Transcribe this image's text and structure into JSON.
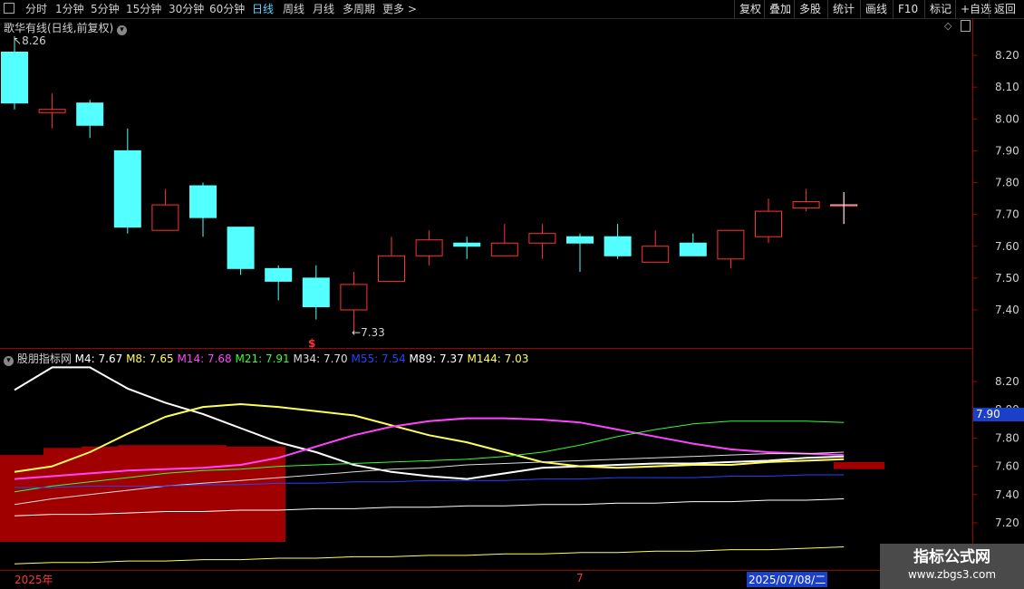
{
  "toolbar": {
    "menu_icon": "square-icon",
    "periods": [
      "分时",
      "1分钟",
      "5分钟",
      "15分钟",
      "30分钟",
      "60分钟",
      "日线",
      "周线",
      "月线",
      "多周期"
    ],
    "active_period": "日线",
    "more": "更多",
    "right_buttons": [
      "复权",
      "叠加",
      "多股",
      "统计",
      "画线",
      "F10",
      "标记",
      "+自选",
      "返回"
    ]
  },
  "price_panel": {
    "title": "歌华有线(日线,前复权)",
    "high_marker": "8.26",
    "low_marker": "7.33",
    "signal_mark": "$",
    "y_ticks": [
      "8.20",
      "8.10",
      "8.00",
      "7.90",
      "7.80",
      "7.70",
      "7.60",
      "7.50",
      "7.40"
    ]
  },
  "indicator_panel": {
    "title": "股朋指标网",
    "ma_values": [
      {
        "label": "M4: 7.67",
        "color": "#ffffff"
      },
      {
        "label": "M8: 7.65",
        "color": "#ffff55"
      },
      {
        "label": "M14: 7.68",
        "color": "#ff44ff"
      },
      {
        "label": "M21: 7.91",
        "color": "#33ff33"
      },
      {
        "label": "M34: 7.70",
        "color": "#dddddd"
      },
      {
        "label": "M55: 7.54",
        "color": "#2244ff"
      },
      {
        "label": "M89: 7.37",
        "color": "#ffffff"
      },
      {
        "label": "M144: 7.03",
        "color": "#ffff55"
      }
    ],
    "y_ticks": [
      "8.20",
      "8.00",
      "7.80",
      "7.60",
      "7.40",
      "7.20"
    ],
    "current_value": "7.90"
  },
  "date_axis": {
    "start": "2025年",
    "month": "7",
    "cursor_date": "2025/07/08/二"
  },
  "watermark": {
    "line1": "指标公式网",
    "line2": "www.zbgs3.com"
  },
  "colors": {
    "up": "#ff3333",
    "down": "#54ffff",
    "axis": "#a00000",
    "background": "#000000",
    "block": "#a00000"
  },
  "chart_data": {
    "type": "candlestick",
    "ylim": [
      7.3,
      8.3
    ],
    "candles": [
      {
        "o": 8.21,
        "h": 8.26,
        "l": 8.03,
        "c": 8.05
      },
      {
        "o": 8.02,
        "h": 8.08,
        "l": 7.97,
        "c": 8.03
      },
      {
        "o": 8.05,
        "h": 8.06,
        "l": 7.94,
        "c": 7.98
      },
      {
        "o": 7.9,
        "h": 7.97,
        "l": 7.64,
        "c": 7.66
      },
      {
        "o": 7.65,
        "h": 7.78,
        "l": 7.65,
        "c": 7.73
      },
      {
        "o": 7.79,
        "h": 7.8,
        "l": 7.63,
        "c": 7.69
      },
      {
        "o": 7.66,
        "h": 7.66,
        "l": 7.51,
        "c": 7.53
      },
      {
        "o": 7.53,
        "h": 7.54,
        "l": 7.43,
        "c": 7.49
      },
      {
        "o": 7.5,
        "h": 7.54,
        "l": 7.37,
        "c": 7.41
      },
      {
        "o": 7.4,
        "h": 7.52,
        "l": 7.33,
        "c": 7.48
      },
      {
        "o": 7.49,
        "h": 7.63,
        "l": 7.49,
        "c": 7.57
      },
      {
        "o": 7.57,
        "h": 7.65,
        "l": 7.54,
        "c": 7.62
      },
      {
        "o": 7.61,
        "h": 7.63,
        "l": 7.56,
        "c": 7.6
      },
      {
        "o": 7.57,
        "h": 7.67,
        "l": 7.57,
        "c": 7.61
      },
      {
        "o": 7.61,
        "h": 7.67,
        "l": 7.56,
        "c": 7.64
      },
      {
        "o": 7.63,
        "h": 7.64,
        "l": 7.52,
        "c": 7.61
      },
      {
        "o": 7.63,
        "h": 7.67,
        "l": 7.56,
        "c": 7.57
      },
      {
        "o": 7.55,
        "h": 7.65,
        "l": 7.55,
        "c": 7.6
      },
      {
        "o": 7.61,
        "h": 7.64,
        "l": 7.57,
        "c": 7.57
      },
      {
        "o": 7.56,
        "h": 7.65,
        "l": 7.53,
        "c": 7.65
      },
      {
        "o": 7.63,
        "h": 7.75,
        "l": 7.61,
        "c": 7.71
      },
      {
        "o": 7.72,
        "h": 7.78,
        "l": 7.71,
        "c": 7.74
      },
      {
        "o": 7.73,
        "h": 7.77,
        "l": 7.67,
        "c": 7.73
      }
    ],
    "indicator_ylim": [
      7.05,
      8.35
    ],
    "series": [
      {
        "name": "M4",
        "color": "#ffffff",
        "width": 2,
        "values": [
          8.14,
          8.3,
          8.3,
          8.15,
          8.05,
          7.97,
          7.87,
          7.77,
          7.7,
          7.61,
          7.56,
          7.53,
          7.51,
          7.55,
          7.59,
          7.6,
          7.61,
          7.62,
          7.62,
          7.63,
          7.64,
          7.66,
          7.67
        ]
      },
      {
        "name": "M8",
        "color": "#ffff55",
        "width": 2,
        "values": [
          7.56,
          7.6,
          7.7,
          7.83,
          7.95,
          8.02,
          8.04,
          8.02,
          7.99,
          7.96,
          7.89,
          7.82,
          7.77,
          7.7,
          7.63,
          7.6,
          7.59,
          7.6,
          7.61,
          7.61,
          7.63,
          7.64,
          7.65
        ]
      },
      {
        "name": "M14",
        "color": "#ff44ff",
        "width": 2,
        "values": [
          7.51,
          7.53,
          7.55,
          7.57,
          7.58,
          7.59,
          7.61,
          7.66,
          7.74,
          7.82,
          7.88,
          7.92,
          7.94,
          7.94,
          7.93,
          7.91,
          7.86,
          7.81,
          7.76,
          7.72,
          7.7,
          7.69,
          7.68
        ]
      },
      {
        "name": "M21",
        "color": "#33ff33",
        "width": 1,
        "values": [
          7.42,
          7.46,
          7.49,
          7.52,
          7.55,
          7.57,
          7.58,
          7.6,
          7.61,
          7.62,
          7.63,
          7.64,
          7.65,
          7.67,
          7.7,
          7.75,
          7.81,
          7.86,
          7.9,
          7.92,
          7.92,
          7.92,
          7.91
        ]
      },
      {
        "name": "M34",
        "color": "#dddddd",
        "width": 1,
        "values": [
          7.33,
          7.37,
          7.4,
          7.43,
          7.46,
          7.48,
          7.5,
          7.52,
          7.54,
          7.56,
          7.58,
          7.59,
          7.61,
          7.62,
          7.63,
          7.64,
          7.65,
          7.66,
          7.67,
          7.68,
          7.69,
          7.69,
          7.7
        ]
      },
      {
        "name": "M55",
        "color": "#2244ff",
        "width": 1,
        "values": [
          7.45,
          7.45,
          7.46,
          7.46,
          7.46,
          7.47,
          7.47,
          7.48,
          7.48,
          7.49,
          7.49,
          7.5,
          7.5,
          7.5,
          7.51,
          7.51,
          7.52,
          7.52,
          7.52,
          7.53,
          7.53,
          7.54,
          7.54
        ]
      },
      {
        "name": "M89",
        "color": "#ffffff",
        "width": 1,
        "values": [
          7.25,
          7.26,
          7.26,
          7.27,
          7.28,
          7.28,
          7.29,
          7.29,
          7.3,
          7.3,
          7.31,
          7.31,
          7.32,
          7.32,
          7.33,
          7.33,
          7.34,
          7.34,
          7.35,
          7.35,
          7.36,
          7.36,
          7.37
        ]
      },
      {
        "name": "M144",
        "color": "#ffff55",
        "width": 1,
        "values": [
          6.91,
          6.92,
          6.92,
          6.93,
          6.93,
          6.94,
          6.94,
          6.95,
          6.95,
          6.96,
          6.96,
          6.97,
          6.97,
          6.98,
          6.98,
          6.99,
          6.99,
          7.0,
          7.0,
          7.01,
          7.01,
          7.02,
          7.03
        ]
      }
    ],
    "block_top_values": [
      7.68,
      7.73,
      7.74,
      7.75,
      7.75,
      7.75,
      7.74,
      7.74
    ]
  }
}
